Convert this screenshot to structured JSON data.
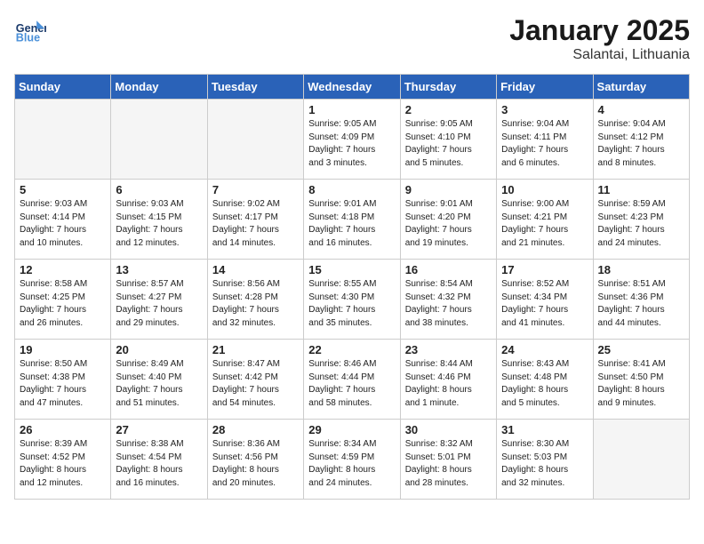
{
  "header": {
    "logo_line1": "General",
    "logo_line2": "Blue",
    "month": "January 2025",
    "location": "Salantai, Lithuania"
  },
  "weekdays": [
    "Sunday",
    "Monday",
    "Tuesday",
    "Wednesday",
    "Thursday",
    "Friday",
    "Saturday"
  ],
  "weeks": [
    [
      {
        "day": "",
        "info": ""
      },
      {
        "day": "",
        "info": ""
      },
      {
        "day": "",
        "info": ""
      },
      {
        "day": "1",
        "info": "Sunrise: 9:05 AM\nSunset: 4:09 PM\nDaylight: 7 hours\nand 3 minutes."
      },
      {
        "day": "2",
        "info": "Sunrise: 9:05 AM\nSunset: 4:10 PM\nDaylight: 7 hours\nand 5 minutes."
      },
      {
        "day": "3",
        "info": "Sunrise: 9:04 AM\nSunset: 4:11 PM\nDaylight: 7 hours\nand 6 minutes."
      },
      {
        "day": "4",
        "info": "Sunrise: 9:04 AM\nSunset: 4:12 PM\nDaylight: 7 hours\nand 8 minutes."
      }
    ],
    [
      {
        "day": "5",
        "info": "Sunrise: 9:03 AM\nSunset: 4:14 PM\nDaylight: 7 hours\nand 10 minutes."
      },
      {
        "day": "6",
        "info": "Sunrise: 9:03 AM\nSunset: 4:15 PM\nDaylight: 7 hours\nand 12 minutes."
      },
      {
        "day": "7",
        "info": "Sunrise: 9:02 AM\nSunset: 4:17 PM\nDaylight: 7 hours\nand 14 minutes."
      },
      {
        "day": "8",
        "info": "Sunrise: 9:01 AM\nSunset: 4:18 PM\nDaylight: 7 hours\nand 16 minutes."
      },
      {
        "day": "9",
        "info": "Sunrise: 9:01 AM\nSunset: 4:20 PM\nDaylight: 7 hours\nand 19 minutes."
      },
      {
        "day": "10",
        "info": "Sunrise: 9:00 AM\nSunset: 4:21 PM\nDaylight: 7 hours\nand 21 minutes."
      },
      {
        "day": "11",
        "info": "Sunrise: 8:59 AM\nSunset: 4:23 PM\nDaylight: 7 hours\nand 24 minutes."
      }
    ],
    [
      {
        "day": "12",
        "info": "Sunrise: 8:58 AM\nSunset: 4:25 PM\nDaylight: 7 hours\nand 26 minutes."
      },
      {
        "day": "13",
        "info": "Sunrise: 8:57 AM\nSunset: 4:27 PM\nDaylight: 7 hours\nand 29 minutes."
      },
      {
        "day": "14",
        "info": "Sunrise: 8:56 AM\nSunset: 4:28 PM\nDaylight: 7 hours\nand 32 minutes."
      },
      {
        "day": "15",
        "info": "Sunrise: 8:55 AM\nSunset: 4:30 PM\nDaylight: 7 hours\nand 35 minutes."
      },
      {
        "day": "16",
        "info": "Sunrise: 8:54 AM\nSunset: 4:32 PM\nDaylight: 7 hours\nand 38 minutes."
      },
      {
        "day": "17",
        "info": "Sunrise: 8:52 AM\nSunset: 4:34 PM\nDaylight: 7 hours\nand 41 minutes."
      },
      {
        "day": "18",
        "info": "Sunrise: 8:51 AM\nSunset: 4:36 PM\nDaylight: 7 hours\nand 44 minutes."
      }
    ],
    [
      {
        "day": "19",
        "info": "Sunrise: 8:50 AM\nSunset: 4:38 PM\nDaylight: 7 hours\nand 47 minutes."
      },
      {
        "day": "20",
        "info": "Sunrise: 8:49 AM\nSunset: 4:40 PM\nDaylight: 7 hours\nand 51 minutes."
      },
      {
        "day": "21",
        "info": "Sunrise: 8:47 AM\nSunset: 4:42 PM\nDaylight: 7 hours\nand 54 minutes."
      },
      {
        "day": "22",
        "info": "Sunrise: 8:46 AM\nSunset: 4:44 PM\nDaylight: 7 hours\nand 58 minutes."
      },
      {
        "day": "23",
        "info": "Sunrise: 8:44 AM\nSunset: 4:46 PM\nDaylight: 8 hours\nand 1 minute."
      },
      {
        "day": "24",
        "info": "Sunrise: 8:43 AM\nSunset: 4:48 PM\nDaylight: 8 hours\nand 5 minutes."
      },
      {
        "day": "25",
        "info": "Sunrise: 8:41 AM\nSunset: 4:50 PM\nDaylight: 8 hours\nand 9 minutes."
      }
    ],
    [
      {
        "day": "26",
        "info": "Sunrise: 8:39 AM\nSunset: 4:52 PM\nDaylight: 8 hours\nand 12 minutes."
      },
      {
        "day": "27",
        "info": "Sunrise: 8:38 AM\nSunset: 4:54 PM\nDaylight: 8 hours\nand 16 minutes."
      },
      {
        "day": "28",
        "info": "Sunrise: 8:36 AM\nSunset: 4:56 PM\nDaylight: 8 hours\nand 20 minutes."
      },
      {
        "day": "29",
        "info": "Sunrise: 8:34 AM\nSunset: 4:59 PM\nDaylight: 8 hours\nand 24 minutes."
      },
      {
        "day": "30",
        "info": "Sunrise: 8:32 AM\nSunset: 5:01 PM\nDaylight: 8 hours\nand 28 minutes."
      },
      {
        "day": "31",
        "info": "Sunrise: 8:30 AM\nSunset: 5:03 PM\nDaylight: 8 hours\nand 32 minutes."
      },
      {
        "day": "",
        "info": ""
      }
    ]
  ]
}
